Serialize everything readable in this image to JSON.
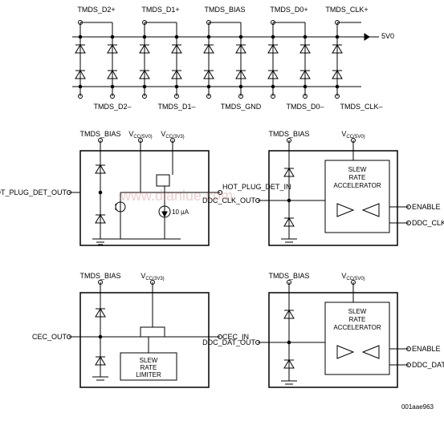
{
  "top": {
    "labels_top": [
      "TMDS_D2+",
      "TMDS_D1+",
      "TMDS_BIAS",
      "TMDS_D0+",
      "TMDS_CLK+"
    ],
    "labels_bot": [
      "TMDS_D2–",
      "TMDS_D1–",
      "TMDS_GND",
      "TMDS_D0–",
      "TMDS_CLK–"
    ],
    "supply": "5V0"
  },
  "hotplug": {
    "top_a": "TMDS_BIAS",
    "top_b_prefix": "V",
    "top_b_sub": "CC(5V0)",
    "top_c_prefix": "V",
    "top_c_sub": "CC(3V3)",
    "left": "HOT_PLUG_DET_OUT",
    "right": "HOT_PLUG_DET_IN",
    "current": "10 µA"
  },
  "cec": {
    "top_a": "TMDS_BIAS",
    "top_b_prefix": "V",
    "top_b_sub": "CC(3V3)",
    "left": "CEC_OUT",
    "right": "CEC_IN",
    "block": "SLEW RATE LIMITER"
  },
  "ddc_clk": {
    "top_a": "TMDS_BIAS",
    "top_b_prefix": "V",
    "top_b_sub": "CC(5V0)",
    "left": "DDC_CLK_OUT",
    "right_a": "ENABLE",
    "right_b": "DDC_CLK_IN",
    "block": "SLEW RATE ACCELERATOR"
  },
  "ddc_dat": {
    "top_a": "TMDS_BIAS",
    "top_b_prefix": "V",
    "top_b_sub": "CC(5V0)",
    "left": "DDC_DAT_OUT",
    "right_a": "ENABLE",
    "right_b": "DDC_DAT_IN",
    "block": "SLEW RATE ACCELERATOR"
  },
  "watermark": "www.dianlue.com",
  "docid": "001aae963"
}
